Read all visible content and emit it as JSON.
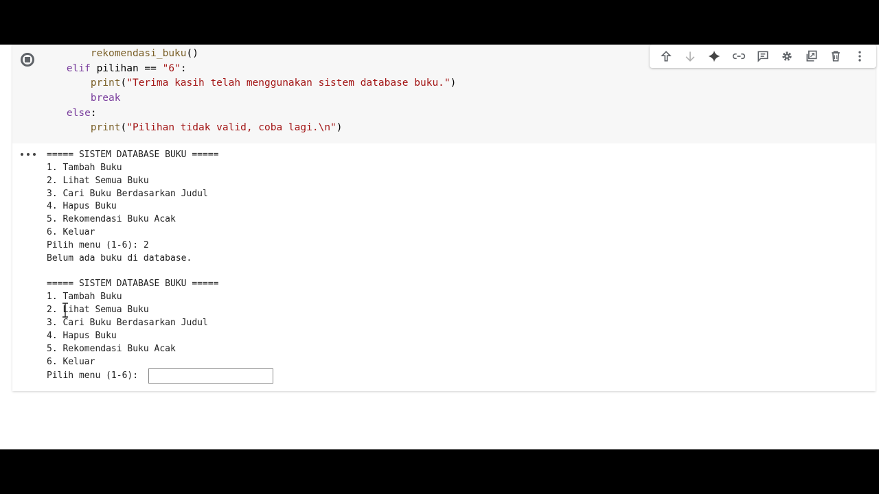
{
  "code_lines": [
    {
      "indent": "        ",
      "parts": [
        {
          "t": "rekomendasi_buku",
          "c": "fn"
        },
        {
          "t": "()",
          "c": ""
        }
      ]
    },
    {
      "indent": "    ",
      "parts": [
        {
          "t": "elif",
          "c": "kw"
        },
        {
          "t": " pilihan == ",
          "c": ""
        },
        {
          "t": "\"6\"",
          "c": "str"
        },
        {
          "t": ":",
          "c": ""
        }
      ]
    },
    {
      "indent": "        ",
      "parts": [
        {
          "t": "print",
          "c": "fn"
        },
        {
          "t": "(",
          "c": ""
        },
        {
          "t": "\"Terima kasih telah menggunakan sistem database buku.\"",
          "c": "str"
        },
        {
          "t": ")",
          "c": ""
        }
      ]
    },
    {
      "indent": "        ",
      "parts": [
        {
          "t": "break",
          "c": "kw"
        }
      ]
    },
    {
      "indent": "    ",
      "parts": [
        {
          "t": "else",
          "c": "kw"
        },
        {
          "t": ":",
          "c": ""
        }
      ]
    },
    {
      "indent": "        ",
      "parts": [
        {
          "t": "print",
          "c": "fn"
        },
        {
          "t": "(",
          "c": ""
        },
        {
          "t": "\"Pilihan tidak valid, coba lagi.\\n\"",
          "c": "str"
        },
        {
          "t": ")",
          "c": ""
        }
      ]
    }
  ],
  "toolbar": {
    "icons": [
      "arrow-up-icon",
      "arrow-down-icon",
      "sparkle-icon",
      "link-icon",
      "comment-icon",
      "gear-icon",
      "mirror-cell-icon",
      "trash-icon",
      "more-vert-icon"
    ]
  },
  "output": {
    "lines": [
      "===== SISTEM DATABASE BUKU =====",
      "1. Tambah Buku",
      "2. Lihat Semua Buku",
      "3. Cari Buku Berdasarkan Judul",
      "4. Hapus Buku",
      "5. Rekomendasi Buku Acak",
      "6. Keluar",
      "Pilih menu (1-6): 2",
      "Belum ada buku di database.",
      "",
      "===== SISTEM DATABASE BUKU =====",
      "1. Tambah Buku",
      "2. Lihat Semua Buku",
      "3. Cari Buku Berdasarkan Judul",
      "4. Hapus Buku",
      "5. Rekomendasi Buku Acak",
      "6. Keluar"
    ],
    "prompt_label": "Pilih menu (1-6): ",
    "input_value": ""
  },
  "colors": {
    "keyword": "#7a3e9d",
    "string": "#a31515",
    "function": "#795e26",
    "icon": "#5f6368"
  }
}
